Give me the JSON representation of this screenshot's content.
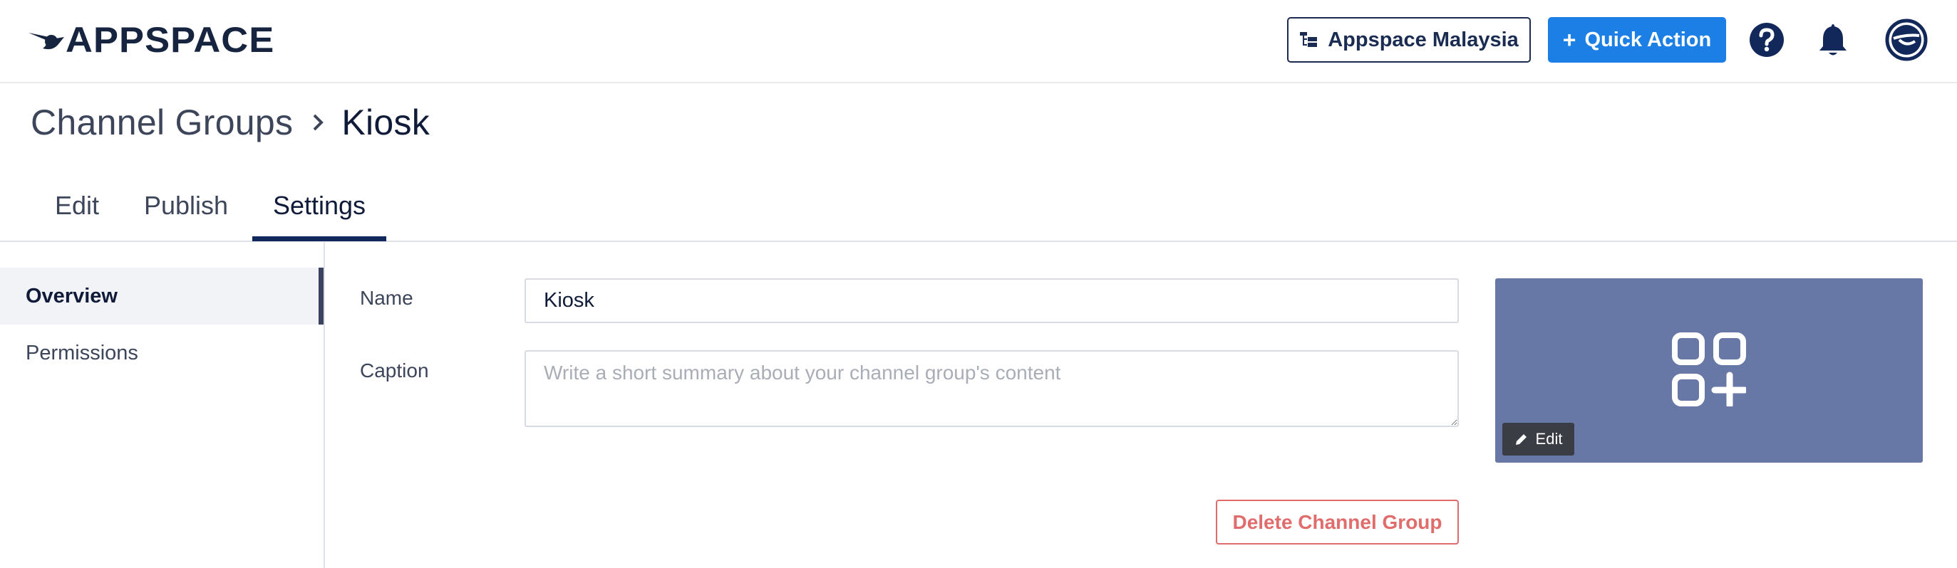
{
  "header": {
    "logo_text": "APPSPACE",
    "org_switcher_label": "Appspace Malaysia",
    "quick_action_label": "Quick Action"
  },
  "breadcrumb": {
    "parent": "Channel Groups",
    "current": "Kiosk"
  },
  "tabs": [
    {
      "label": "Edit",
      "active": false
    },
    {
      "label": "Publish",
      "active": false
    },
    {
      "label": "Settings",
      "active": true
    }
  ],
  "sidenav": {
    "items": [
      {
        "label": "Overview",
        "active": true
      },
      {
        "label": "Permissions",
        "active": false
      }
    ]
  },
  "form": {
    "name_label": "Name",
    "name_value": "Kiosk",
    "caption_label": "Caption",
    "caption_value": "",
    "caption_placeholder": "Write a short summary about your channel group's content"
  },
  "thumbnail": {
    "edit_label": "Edit",
    "background_color": "#6878a6",
    "icon": "apps-add-icon"
  },
  "actions": {
    "delete_label": "Delete Channel Group"
  },
  "colors": {
    "primary_navy": "#13285a",
    "accent_blue": "#1b7fe6",
    "danger": "#e06c6c"
  }
}
